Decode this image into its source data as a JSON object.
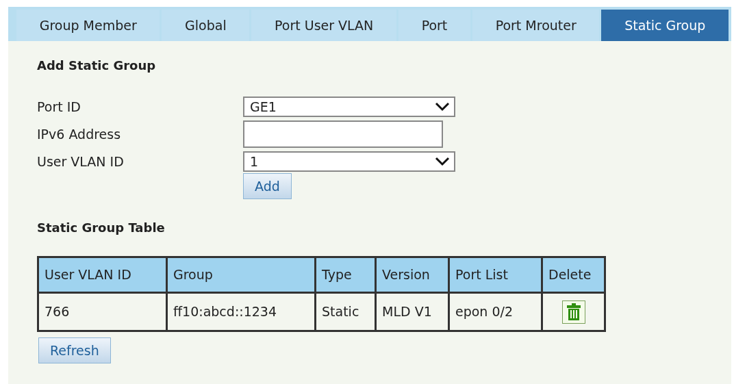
{
  "tabs": [
    {
      "label": "Group Member",
      "selected": false
    },
    {
      "label": "Global",
      "selected": false
    },
    {
      "label": "Port User VLAN",
      "selected": false
    },
    {
      "label": "Port",
      "selected": false
    },
    {
      "label": "Port Mrouter",
      "selected": false
    },
    {
      "label": "Static Group",
      "selected": true
    }
  ],
  "add_section": {
    "title": "Add Static Group",
    "fields": [
      {
        "kind": "select",
        "label": "Port ID",
        "value": "GE1"
      },
      {
        "kind": "text",
        "label": "IPv6 Address"
      },
      {
        "kind": "select",
        "label": "User VLAN ID",
        "value": "1"
      }
    ],
    "button": "Add"
  },
  "table_section": {
    "title": "Static Group Table",
    "columns": [
      "User VLAN ID",
      "Group",
      "Type",
      "Version",
      "Port List",
      "Delete"
    ],
    "rows": [
      {
        "user_vlan_id": "766",
        "group": "ff10:abcd::1234",
        "type": "Static",
        "version": "MLD V1",
        "port_list": "epon 0/2"
      }
    ],
    "button": "Refresh"
  }
}
